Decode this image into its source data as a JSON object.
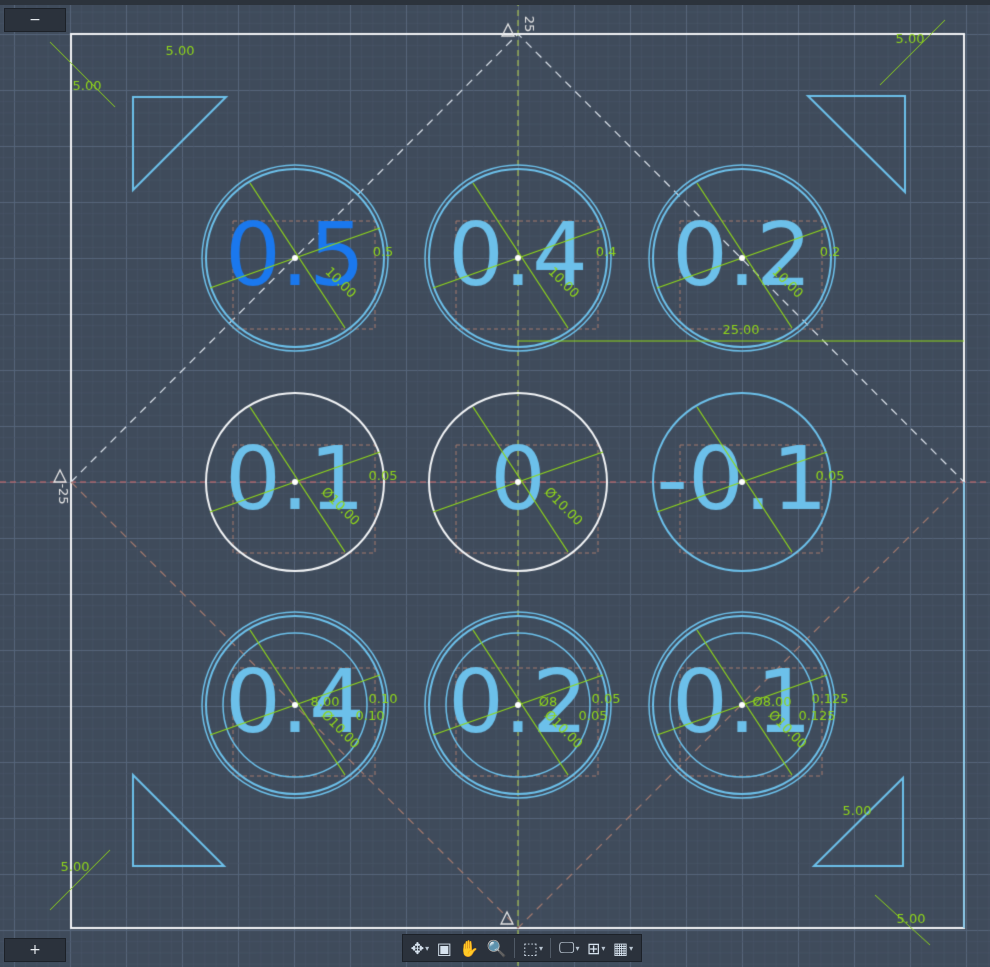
{
  "colors": {
    "background": "#3f4b5b",
    "grid_minor": "#4b5869",
    "grid_major": "#56657a",
    "sheet_border": "#f2f4f6",
    "dimension": "#8fd61a",
    "sketch_blue": "#6cc0ea",
    "selected_text": "#1a78ee",
    "constraint": "#e6e6e6",
    "axis_x": "#d86a6a",
    "axis_y": "#b9d64a",
    "hidden_box": "#a57a6e"
  },
  "axis_labels": {
    "top": "25",
    "left": "-25"
  },
  "circles": [
    {
      "label": "0.5",
      "outer_ring": true,
      "inner_ring": false,
      "ring_color": "#6cc0ea",
      "text_color": "#1a78ee",
      "diameter_label": "10.00",
      "offset_label": "0.5"
    },
    {
      "label": "0.4",
      "outer_ring": true,
      "inner_ring": false,
      "ring_color": "#6cc0ea",
      "text_color": "#6cc0ea",
      "diameter_label": "10.00",
      "offset_label": "0.4"
    },
    {
      "label": "0.2",
      "outer_ring": true,
      "inner_ring": false,
      "ring_color": "#6cc0ea",
      "text_color": "#6cc0ea",
      "diameter_label": "10.00",
      "offset_label": "0.2"
    },
    {
      "label": "0.1",
      "outer_ring": false,
      "inner_ring": false,
      "ring_color": "#f2f4f6",
      "text_color": "#6cc0ea",
      "diameter_label": "Ø10.00",
      "offset_label": "0.05"
    },
    {
      "label": "0",
      "outer_ring": false,
      "inner_ring": false,
      "ring_color": "#f2f4f6",
      "text_color": "#6cc0ea",
      "diameter_label": "Ø10.00",
      "offset_label": ""
    },
    {
      "label": "-0.1",
      "outer_ring": false,
      "inner_ring": false,
      "ring_color": "#6cc0ea",
      "text_color": "#6cc0ea",
      "diameter_label": "",
      "offset_label": "0.05"
    },
    {
      "label": "0.4",
      "outer_ring": true,
      "inner_ring": true,
      "ring_color": "#6cc0ea",
      "text_color": "#6cc0ea",
      "diameter_label": "Ø10.00",
      "offset_label": "0.10",
      "inner_label": "8.00",
      "inner_offset": "0.10"
    },
    {
      "label": "0.2",
      "outer_ring": true,
      "inner_ring": true,
      "ring_color": "#6cc0ea",
      "text_color": "#6cc0ea",
      "diameter_label": "Ø10.00",
      "offset_label": "0.05",
      "inner_label": "Ø8",
      "inner_offset": "0.05"
    },
    {
      "label": "0.1",
      "outer_ring": true,
      "inner_ring": true,
      "ring_color": "#6cc0ea",
      "text_color": "#6cc0ea",
      "diameter_label": "Ø10.00",
      "offset_label": "0.125",
      "inner_label": "Ø8.00",
      "inner_offset": "0.125"
    }
  ],
  "dimensions": {
    "horizontal_25": "25.00",
    "corner_five": "5.00",
    "small_zero": "0.0"
  },
  "buttons": {
    "zoom_out": "−",
    "zoom_in": "+"
  },
  "nav_tools": [
    {
      "name": "orbit-tool",
      "glyph": "✥",
      "caret": "▾"
    },
    {
      "name": "look-at-tool",
      "glyph": "▣",
      "caret": ""
    },
    {
      "name": "pan-tool",
      "glyph": "✋",
      "caret": ""
    },
    {
      "name": "zoom-tool",
      "glyph": "🔍",
      "caret": ""
    },
    {
      "name": "fit-tool",
      "glyph": "⬚",
      "caret": "▾"
    },
    {
      "name": "display-settings-tool",
      "glyph": "🖵",
      "caret": "▾"
    },
    {
      "name": "grid-settings-tool",
      "glyph": "⊞",
      "caret": "▾"
    },
    {
      "name": "viewports-tool",
      "glyph": "▦",
      "caret": "▾"
    }
  ]
}
